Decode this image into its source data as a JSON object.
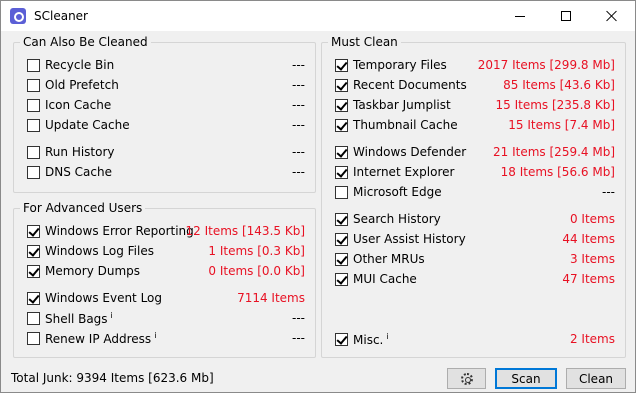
{
  "window": {
    "title": "SCleaner"
  },
  "also_cleaned": {
    "heading": "Can Also Be Cleaned",
    "items": [
      {
        "label": "Recycle Bin",
        "value": "---",
        "checked": false
      },
      {
        "label": "Old Prefetch",
        "value": "---",
        "checked": false
      },
      {
        "label": "Icon Cache",
        "value": "---",
        "checked": false
      },
      {
        "label": "Update Cache",
        "value": "---",
        "checked": false
      },
      {
        "label": "Run History",
        "value": "---",
        "checked": false
      },
      {
        "label": "DNS Cache",
        "value": "---",
        "checked": false
      }
    ]
  },
  "advanced": {
    "heading": "For Advanced Users",
    "items": [
      {
        "label": "Windows Error Reporting",
        "value": "12 Items [143.5 Kb]",
        "checked": true
      },
      {
        "label": "Windows Log Files",
        "value": "1 Items [0.3 Kb]",
        "checked": true
      },
      {
        "label": "Memory Dumps",
        "value": "0 Items [0.0 Kb]",
        "checked": true
      },
      {
        "label": "Windows Event Log",
        "value": "7114 Items",
        "checked": true
      },
      {
        "label": "Shell Bags",
        "sup": "i",
        "value": "---",
        "checked": false
      },
      {
        "label": "Renew IP Address",
        "sup": "i",
        "value": "---",
        "checked": false
      }
    ]
  },
  "must_clean": {
    "heading": "Must Clean",
    "items": [
      {
        "label": "Temporary Files",
        "value": "2017 Items [299.8 Mb]",
        "checked": true
      },
      {
        "label": "Recent Documents",
        "value": "85 Items [43.6 Kb]",
        "checked": true
      },
      {
        "label": "Taskbar Jumplist",
        "value": "15 Items [235.8 Kb]",
        "checked": true
      },
      {
        "label": "Thumbnail Cache",
        "value": "15 Items [7.4 Mb]",
        "checked": true
      },
      {
        "label": "Windows Defender",
        "value": "21 Items [259.4 Mb]",
        "checked": true
      },
      {
        "label": "Internet Explorer",
        "value": "18 Items [56.6 Mb]",
        "checked": true
      },
      {
        "label": "Microsoft Edge",
        "value": "---",
        "checked": false
      },
      {
        "label": "Search History",
        "value": "0 Items",
        "checked": true
      },
      {
        "label": "User Assist History",
        "value": "44 Items",
        "checked": true
      },
      {
        "label": "Other MRUs",
        "value": "3 Items",
        "checked": true
      },
      {
        "label": "MUI Cache",
        "value": "47 Items",
        "checked": true
      },
      {
        "label": "Misc.",
        "sup": "i",
        "value": "2 Items",
        "checked": true
      }
    ]
  },
  "footer": {
    "status": "Total Junk: 9394 Items [623.6 Mb]",
    "scan_label": "Scan",
    "clean_label": "Clean",
    "settings_icon": "gear-icon"
  },
  "colors": {
    "value_red": "#e81123",
    "accent": "#0078d7"
  }
}
